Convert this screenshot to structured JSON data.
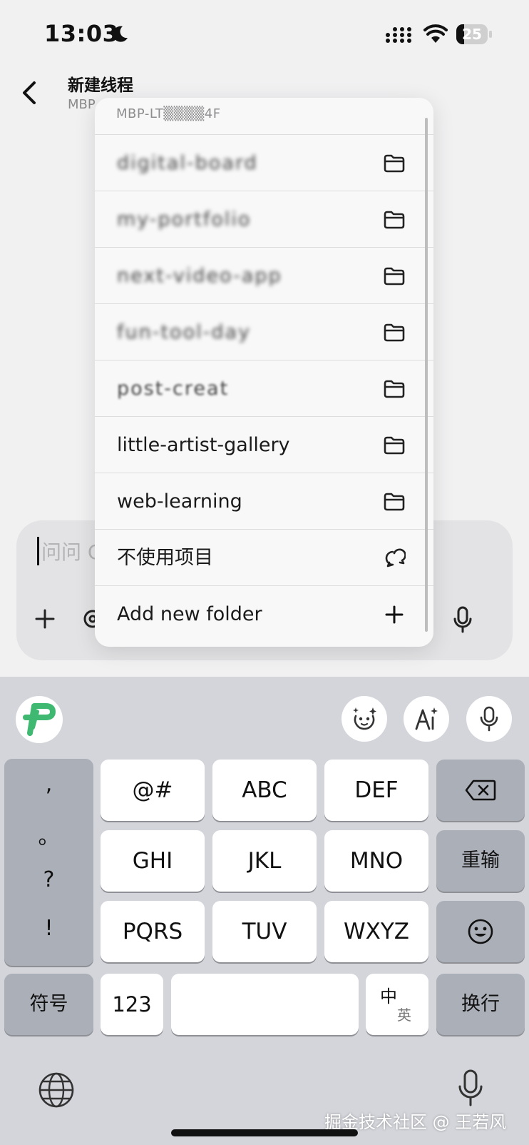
{
  "status_bar": {
    "time": "13:03",
    "battery_level": "25",
    "battery_fraction": 0.25
  },
  "header": {
    "title": "新建线程",
    "subtitle": "MBP"
  },
  "dropdown": {
    "header": "MBP-LT▒▒▒▒4F",
    "items": [
      {
        "label": "digital-board",
        "icon": "folder-icon"
      },
      {
        "label": "my-portfolio",
        "icon": "folder-icon"
      },
      {
        "label": "next-video-app",
        "icon": "folder-icon"
      },
      {
        "label": "fun-tool-day",
        "icon": "folder-icon"
      },
      {
        "label": "post-creat",
        "icon": "folder-icon"
      },
      {
        "label": "little-artist-gallery",
        "icon": "folder-icon"
      },
      {
        "label": "web-learning",
        "icon": "folder-icon"
      },
      {
        "label": "不使用项目",
        "icon": "chat-bubbles-icon"
      },
      {
        "label": "Add new folder",
        "icon": "plus-icon"
      }
    ]
  },
  "composer": {
    "placeholder": "问问 C"
  },
  "keyboard": {
    "punctuation": [
      ",",
      "。",
      "?",
      "!"
    ],
    "rows": [
      [
        "@#",
        "ABC",
        "DEF"
      ],
      [
        "GHI",
        "JKL",
        "MNO"
      ],
      [
        "PQRS",
        "TUV",
        "WXYZ"
      ]
    ],
    "backspace_icon": "backspace-icon",
    "retype": "重输",
    "emoji_icon": "emoji-icon",
    "symbols": "符号",
    "numbers": "123",
    "lang_main": "中",
    "lang_alt": "英",
    "enter": "换行"
  },
  "watermark": "掘金技术社区 @ 王若风",
  "colors": {
    "accent_green": "#3fb872",
    "keyboard_bg": "#d3d5da",
    "dark_key": "#abafb8"
  }
}
